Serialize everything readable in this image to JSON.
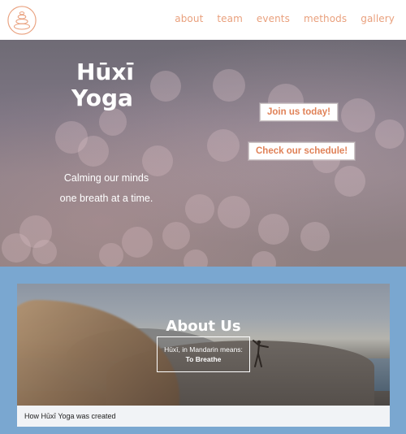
{
  "header": {
    "logo_icon": "stacked-stones-logo-icon",
    "nav": [
      {
        "label": "about"
      },
      {
        "label": "team"
      },
      {
        "label": "events"
      },
      {
        "label": "methods"
      },
      {
        "label": "gallery"
      }
    ]
  },
  "hero": {
    "title_line1": "Hūxī",
    "title_line2": "Yoga",
    "tagline_line1": "Calming our minds",
    "tagline_line2": "one breath at a time.",
    "join_button": "Join us today!",
    "schedule_button": "Check our schedule!"
  },
  "about": {
    "title": "About Us",
    "box_line1": "Hūxī, in Mandarin means:",
    "box_line2": "To Breathe",
    "caption": "How Hūxī Yoga was created"
  },
  "colors": {
    "accent": "#e9a07d",
    "about_bg": "#7aa7d0"
  }
}
